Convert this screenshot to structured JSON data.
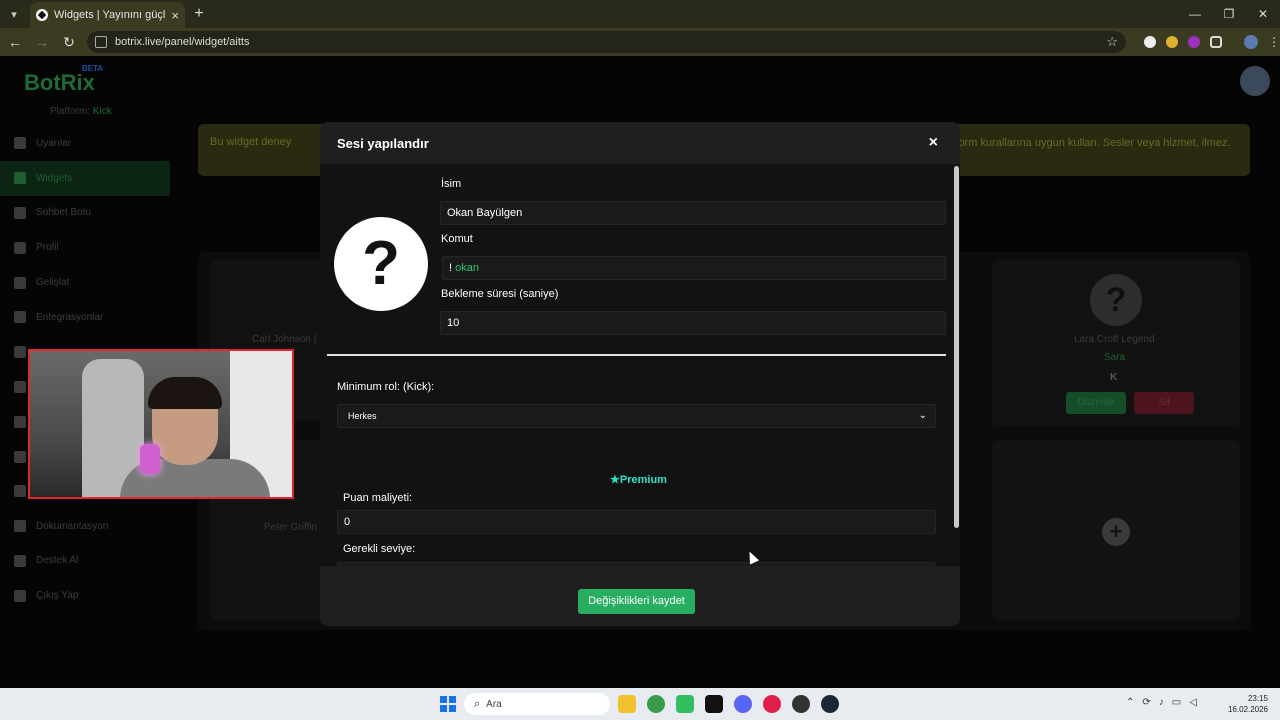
{
  "browser": {
    "tab_title": "Widgets | Yayınını güçlendirmek",
    "url": "botrix.live/panel/widget/aitts",
    "window_controls": [
      "minimize",
      "maximize",
      "close"
    ]
  },
  "app": {
    "brand": "BotRix",
    "brand_badge": "BETA",
    "platform_label": "Platform:",
    "platform_value": "Kick",
    "sidebar": [
      {
        "label": "Uyarılar",
        "icon": "warning-icon"
      },
      {
        "label": "Widgets",
        "icon": "widgets-icon",
        "active": true
      },
      {
        "label": "Sohbet Botu",
        "icon": "bot-icon"
      },
      {
        "label": "Profil",
        "icon": "profile-icon"
      },
      {
        "label": "Gelişlat",
        "icon": "trophy-icon"
      },
      {
        "label": "Entegrasyonlar",
        "icon": "integrations-icon"
      },
      {
        "label": "",
        "icon": "chart-icon"
      },
      {
        "label": "",
        "icon": "music-icon"
      },
      {
        "label": "",
        "icon": "game-icon"
      },
      {
        "label": "",
        "icon": "users-icon"
      },
      {
        "label": "",
        "icon": "donate-icon"
      },
      {
        "label": "Dokümantasyon",
        "icon": "docs-icon"
      },
      {
        "label": "Destek Al",
        "icon": "help-icon"
      },
      {
        "label": "Çıkış Yap",
        "icon": "logout-icon"
      }
    ],
    "warning_left": "Bu widget deney",
    "warning_right": "lorm kurallarına uygun kullan. Sesler veya hizmet, ilmez.",
    "cards": {
      "left_top_name": "Carl Johnson (",
      "left_bottom_name": "Peter Griffin",
      "right_name": "Lara Croft Legend",
      "right_sub": "Sara",
      "right_edit": "Düzenle",
      "right_delete": "Sil"
    }
  },
  "modal": {
    "title": "Sesi yapılandır",
    "close_glyph": "×",
    "avatar_glyph": "?",
    "name_label": "İsim",
    "name_value": "Okan Bayülgen",
    "command_label": "Komut",
    "command_prefix": "!",
    "command_value": "okan",
    "cooldown_label": "Bekleme süresi (saniye)",
    "cooldown_value": "10",
    "min_role_label": "Minimum rol: (Kick):",
    "min_role_value": "Herkes",
    "premium_label": "Premium",
    "points_label": "Puan maliyeti:",
    "points_value": "0",
    "level_label": "Gerekli seviye:",
    "save_label": "Değişiklikleri kaydet"
  },
  "taskbar": {
    "search_placeholder": "Ara",
    "time": "23:15",
    "date": "16.02.2026"
  },
  "colors": {
    "accent_green": "#27ae60",
    "command_green": "#2ecc71",
    "premium_teal": "#2ee0c8",
    "webcam_border": "#e02828"
  }
}
